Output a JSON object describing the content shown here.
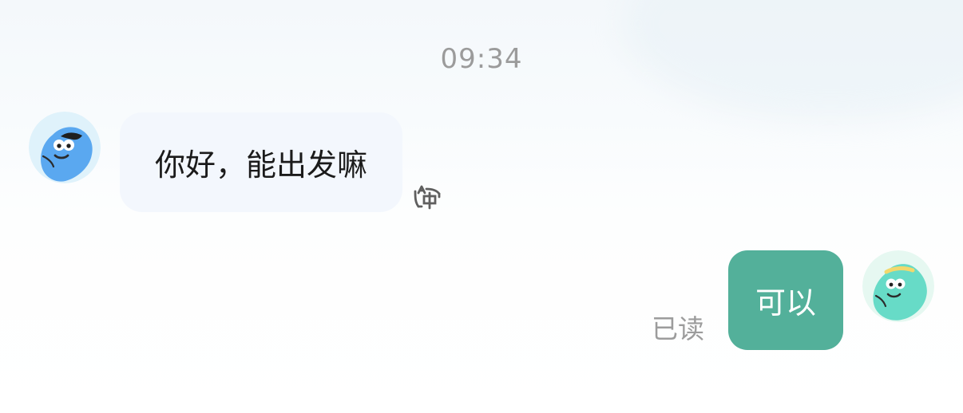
{
  "chat": {
    "timestamp": "09:34",
    "incoming_message": {
      "text": "你好，能出发嘛",
      "avatar_icon": "blue-character-avatar-icon",
      "translate_icon": "translate-icon"
    },
    "outgoing_message": {
      "text": "可以",
      "avatar_icon": "teal-character-avatar-icon",
      "status": "已读"
    }
  },
  "colors": {
    "incoming_bubble": "#f3f7fd",
    "outgoing_bubble": "#53b09a",
    "timestamp_text": "#9b9b9b",
    "status_text": "#9c9c9c",
    "incoming_avatar_bg": "#dff2fb",
    "outgoing_avatar_bg": "#e6f8f1",
    "incoming_character": "#5aa8f0",
    "outgoing_character": "#67dbc7"
  }
}
